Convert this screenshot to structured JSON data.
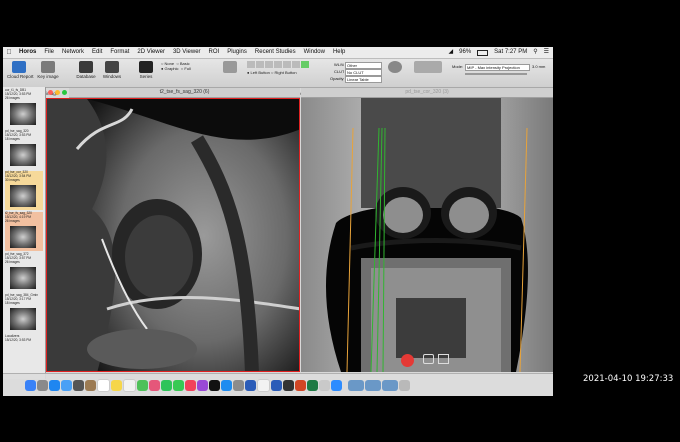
{
  "menubar": {
    "app": "Horos",
    "items": [
      "File",
      "Network",
      "Edit",
      "Format",
      "2D Viewer",
      "3D Viewer",
      "ROI",
      "Plugins",
      "Recent Studies",
      "Window",
      "Help"
    ],
    "battery": "96%",
    "datetime": "Sat 7:27 PM"
  },
  "toolbar": {
    "cloud_report": "Cloud Report",
    "key_image": "Key image",
    "database": "Database",
    "windows": "Windows",
    "series": "Series",
    "annotations": "Annotations",
    "patient": "Patient",
    "mouse_function": "Mouse button function",
    "wlww": "WL/WW & CLUT",
    "two_d3d": "2D/3D",
    "orientation": "Orientation",
    "thick_slab": "Thick Slab",
    "annot_opts": [
      "None",
      "Graphic",
      "Basic",
      "Full"
    ],
    "mouse_opts": [
      "Left Button",
      "Right Button"
    ],
    "wlww_field": "Other",
    "clut_field": "No CLUT",
    "opacity_field": "Linear Table",
    "mode_field": "MIP - Max intensity Projection",
    "mode_label": "Mode:",
    "slab_value": "3.0 mm",
    "wlww_label": "WL/WW:",
    "clut_label": "CLUT:",
    "opacity_label": "Opacity:"
  },
  "viewers": {
    "left_title": "t2_tse_fs_sag_320 (6)",
    "right_title": "pd_tse_cor_320 (3)"
  },
  "sidebar": {
    "thumbs": [
      {
        "name": "cor_t1_fs_DB1",
        "meta": "15/12/20, 3:53 PM",
        "count": "26 images",
        "selected": false
      },
      {
        "name": "pd_tse_sag_320",
        "meta": "15/12/20, 3:53 PM",
        "count": "18 images",
        "selected": false
      },
      {
        "name": "pd_tse_cor_320",
        "meta": "15/12/20, 3:54 PM",
        "count": "30 images",
        "selected": true
      },
      {
        "name": "t2_tse_fs_sag_320",
        "meta": "15/12/20, 4:19 PM",
        "count": "26 images",
        "selected": true
      },
      {
        "name": "pd_fse_sag_372",
        "meta": "15/12/20, 3:57 PM",
        "count": "26 images",
        "selected": false
      },
      {
        "name": "pd_tse_sag_384_Gmin",
        "meta": "15/12/20, 3:17 PM",
        "count": "18 images",
        "selected": false
      },
      {
        "name": "Localizers",
        "meta": "15/12/20, 3:53 PM",
        "count": "",
        "selected": false
      }
    ]
  },
  "status": {
    "timestamp": "2021-04-10 19:27:33"
  },
  "colors": {
    "selection_border": "#e02020",
    "record_button": "#e53935",
    "orange_line": "#e8a33a",
    "green_line": "#31b531"
  },
  "dock": {
    "icons": [
      "finder-icon",
      "launchpad-icon",
      "safari-icon",
      "mail-icon",
      "photos-icon",
      "contacts-icon",
      "calendar-icon",
      "notes-icon",
      "reminders-icon",
      "maps-icon",
      "photos2-icon",
      "facetime-icon",
      "messages-icon",
      "music-icon",
      "podcasts-icon",
      "tv-icon",
      "appstore-icon",
      "prefs-icon",
      "word-icon",
      "chrome-icon",
      "horos-icon",
      "cursor-icon",
      "powerpoint-icon",
      "excel-icon",
      "preview-icon",
      "zoom-icon",
      "folder-icon",
      "folder2-icon",
      "folder3-icon",
      "trash-icon"
    ]
  }
}
